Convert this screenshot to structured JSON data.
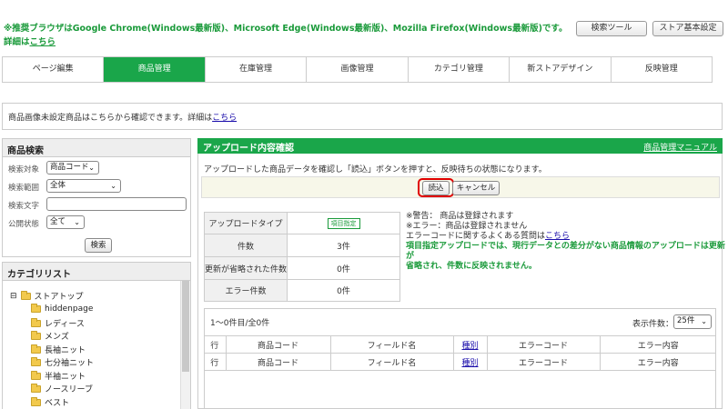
{
  "notice": {
    "line1": "※推奨ブラウザはGoogle Chrome(Windows最新版)、Microsoft Edge(Windows最新版)、Mozilla Firefox(Windows最新版)です。",
    "line2_prefix": "詳細は",
    "line2_link": "こちら"
  },
  "top_buttons": {
    "search_tool": "検索ツール",
    "store_basic": "ストア基本設定"
  },
  "tabs": [
    "ページ編集",
    "商品管理",
    "在庫管理",
    "画像管理",
    "カテゴリ管理",
    "新ストアデザイン",
    "反映管理"
  ],
  "info": {
    "text": "商品画像未設定商品はこちらから確認できます。詳細は",
    "link": "こちら"
  },
  "search": {
    "title": "商品検索",
    "target_label": "検索対象",
    "target_value": "商品コード",
    "range_label": "検索範囲",
    "range_value": "全体",
    "text_label": "検索文字",
    "text_value": "",
    "status_label": "公開状態",
    "status_value": "全て",
    "button": "検索"
  },
  "category": {
    "title": "カテゴリリスト",
    "root_toggle": "⊟",
    "root": "ストアトップ",
    "items": [
      "hiddenpage",
      "レディース",
      "メンズ",
      "長袖ニット",
      "七分袖ニット",
      "半袖ニット",
      "ノースリーブ",
      "ベスト"
    ]
  },
  "main": {
    "title": "アップロード内容確認",
    "manual_link": "商品管理マニュアル",
    "description": "アップロードした商品データを確認し「読込」ボタンを押すと、反映待ちの状態になります。",
    "load_button": "読込",
    "cancel_button": "キャンセル",
    "highlight_color": "#e00000"
  },
  "summary": {
    "rows": [
      {
        "label": "アップロードタイプ",
        "value": "項目指定"
      },
      {
        "label": "件数",
        "value": "3件"
      },
      {
        "label": "更新が省略された件数",
        "value": "0件"
      },
      {
        "label": "エラー件数",
        "value": "0件"
      }
    ]
  },
  "notes": {
    "warning": "※警告： 商品は登録されます",
    "error": "※エラー：商品は登録されません",
    "faq_prefix": "エラーコードに関するよくある質問は",
    "faq_link": "こちら",
    "green1": "項目指定アップロードでは、現行データとの差分がない商品情報のアップロードは更新が",
    "green2": "省略され、件数に反映されません。"
  },
  "results": {
    "count_text": "1〜0件目/全0件",
    "per_page_label": "表示件数：",
    "per_page_value": "25件",
    "headers": [
      "行",
      "商品コード",
      "フィールド名",
      "種別",
      "エラーコード",
      "エラー内容"
    ]
  }
}
